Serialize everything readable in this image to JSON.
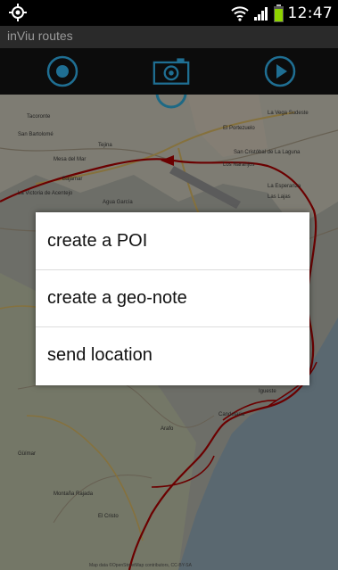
{
  "status_bar": {
    "time": "12:47",
    "icons": [
      "gps-icon",
      "wifi-icon",
      "signal-icon",
      "battery-icon"
    ],
    "battery_color": "#8ed400"
  },
  "app": {
    "title": "inViu routes"
  },
  "toolbar": {
    "icons": [
      "record-icon",
      "camera-icon",
      "play-icon"
    ],
    "accent_color": "#33b5e5"
  },
  "map": {
    "labels": [
      "Tacoronte",
      "La Vega Sudeste",
      "San Bartolomé",
      "San Cristóbal de La Laguna",
      "Mesa del Mar",
      "El Portezuelo",
      "Tejina",
      "Bajamar",
      "La Esperanza",
      "Las Lajas",
      "Los Naranjos",
      "La Victoria de Acentejo",
      "Agua García",
      "Candelaria",
      "Igueste",
      "Arafo",
      "Güímar",
      "Montaña Rajada",
      "El Cristo"
    ],
    "route_color": "#c00000",
    "attribution": "Map data ©OpenStreetMap contributors, CC-BY-SA"
  },
  "menu": {
    "items": [
      {
        "label": "create a POI"
      },
      {
        "label": "create a geo-note"
      },
      {
        "label": "send location"
      }
    ]
  }
}
